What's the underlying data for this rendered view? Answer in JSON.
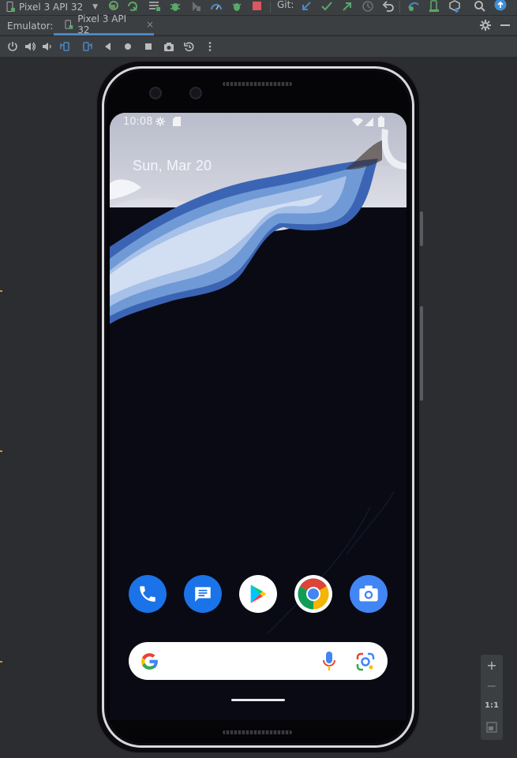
{
  "toolbar": {
    "device_combo": "Pixel 3 API 32",
    "git_label": "Git:"
  },
  "tool_window": {
    "title": "Emulator:",
    "tab_label": "Pixel 3 API 32"
  },
  "phone": {
    "status_time": "10:08",
    "date_widget": "Sun, Mar 20",
    "dock_apps": [
      "phone-app",
      "messages-app",
      "play-store-app",
      "chrome-app",
      "camera-app"
    ]
  },
  "zoom_controls": {
    "plus": "+",
    "minus": "−",
    "one_to_one": "1:1"
  },
  "colors": {
    "ide_bg": "#2b2d30",
    "toolbar_bg": "#3c3f41",
    "accent_blue": "#4a88c7",
    "run_green": "#59a869",
    "stop_red": "#db5860",
    "wallpaper_blue": "#6f9ad6"
  }
}
